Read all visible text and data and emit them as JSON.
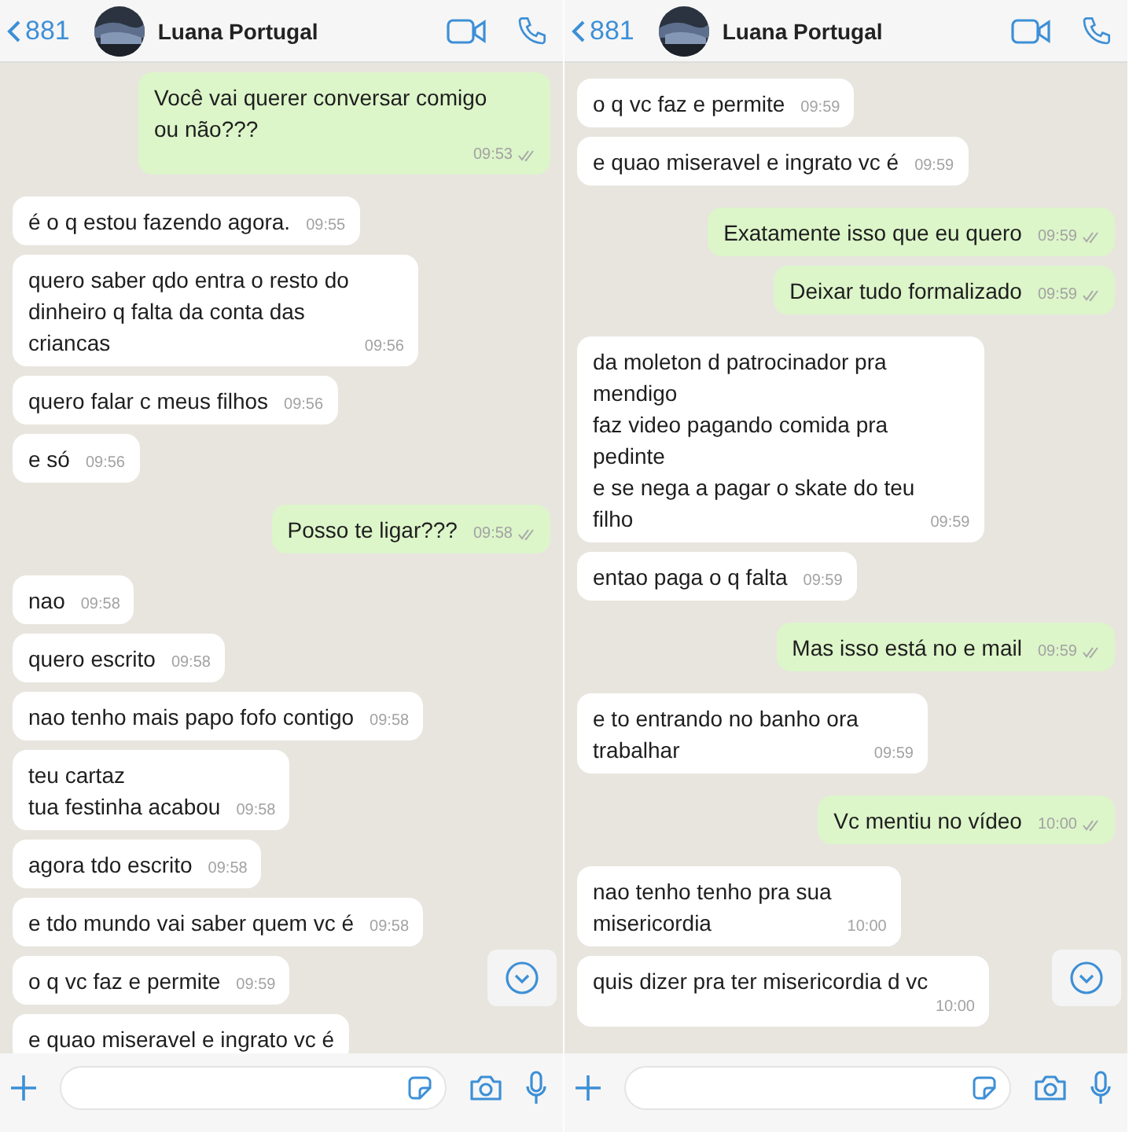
{
  "panels": [
    {
      "header": {
        "back_label": "881",
        "name": "Luana Portugal"
      },
      "messages": [
        {
          "kind": "fragment"
        },
        {
          "kind": "sent",
          "text": "Você vai querer conversar comigo\nou não???",
          "time": "09:53",
          "delivered": true
        },
        {
          "kind": "received",
          "text": "é o q estou fazendo agora.",
          "time": "09:55"
        },
        {
          "kind": "received",
          "text": "quero saber qdo entra o resto do\ndinheiro q falta da conta das\ncriancas",
          "time": "09:56"
        },
        {
          "kind": "received",
          "text": "quero falar c meus filhos",
          "time": "09:56"
        },
        {
          "kind": "received",
          "text": "e só",
          "time": "09:56"
        },
        {
          "kind": "sent",
          "text": "Posso te ligar???",
          "time": "09:58",
          "delivered": true
        },
        {
          "kind": "received",
          "text": "nao",
          "time": "09:58"
        },
        {
          "kind": "received",
          "text": "quero escrito",
          "time": "09:58"
        },
        {
          "kind": "received",
          "text": "nao tenho mais papo fofo contigo",
          "time": "09:58"
        },
        {
          "kind": "received",
          "text": "teu cartaz\ntua festinha acabou",
          "time": "09:58"
        },
        {
          "kind": "received",
          "text": "agora tdo escrito",
          "time": "09:58"
        },
        {
          "kind": "received",
          "text": "e tdo mundo vai saber quem vc é",
          "time": "09:58"
        },
        {
          "kind": "received",
          "text": "o q vc faz e permite",
          "time": "09:59"
        },
        {
          "kind": "received",
          "text": "e quao miseravel e ingrato vc é"
        }
      ]
    },
    {
      "header": {
        "back_label": "881",
        "name": "Luana Portugal"
      },
      "messages": [
        {
          "kind": "received",
          "text": "o q vc faz e permite",
          "time": "09:59"
        },
        {
          "kind": "received",
          "text": "e quao miseravel e ingrato vc é",
          "time": "09:59"
        },
        {
          "kind": "sent",
          "text": "Exatamente isso que eu quero",
          "time": "09:59",
          "delivered": true
        },
        {
          "kind": "sent",
          "text": "Deixar tudo formalizado",
          "time": "09:59",
          "delivered": true
        },
        {
          "kind": "received",
          "text": "da moleton d patrocinador pra\nmendigo\nfaz video pagando comida pra\npedinte\ne se nega a pagar o skate do teu\nfilho",
          "time": "09:59"
        },
        {
          "kind": "received",
          "text": "entao paga o q falta",
          "time": "09:59"
        },
        {
          "kind": "sent",
          "text": "Mas isso está no e mail",
          "time": "09:59",
          "delivered": true
        },
        {
          "kind": "received",
          "text": "e to entrando no banho ora\ntrabalhar",
          "time": "09:59"
        },
        {
          "kind": "sent",
          "text": "Vc mentiu no vídeo",
          "time": "10:00",
          "delivered": true
        },
        {
          "kind": "received",
          "text": "nao tenho tenho pra sua\nmisericordia",
          "time": "10:00"
        },
        {
          "kind": "received",
          "text": "quis dizer pra ter misericordia d vc",
          "time": "10:00"
        }
      ]
    }
  ]
}
